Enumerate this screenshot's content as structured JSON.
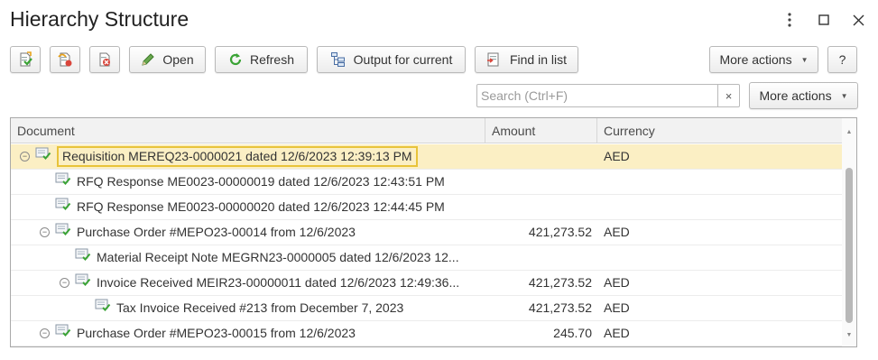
{
  "window": {
    "title": "Hierarchy Structure",
    "controls": {
      "menu_icon": "more-vert-icon",
      "maximize_icon": "maximize-icon",
      "close_icon": "close-icon"
    }
  },
  "toolbar": {
    "open_label": "Open",
    "refresh_label": "Refresh",
    "output_label": "Output for current",
    "find_label": "Find in list",
    "more_actions_label": "More actions",
    "help_label": "?"
  },
  "search": {
    "placeholder": "Search (Ctrl+F)",
    "value": "",
    "clear_label": "×",
    "more_actions_label": "More actions"
  },
  "table": {
    "columns": [
      "Document",
      "Amount",
      "Currency"
    ],
    "rows": [
      {
        "level": 0,
        "toggle": "⊖",
        "document": "Requisition MEREQ23-0000021 dated 12/6/2023 12:39:13 PM",
        "amount": "",
        "currency": "AED",
        "selected": true
      },
      {
        "level": 1,
        "toggle": "",
        "document": "RFQ Response ME0023-00000019 dated 12/6/2023 12:43:51 PM",
        "amount": "",
        "currency": ""
      },
      {
        "level": 1,
        "toggle": "",
        "document": "RFQ Response ME0023-00000020 dated 12/6/2023 12:44:45 PM",
        "amount": "",
        "currency": ""
      },
      {
        "level": 1,
        "toggle": "⊖",
        "document": "Purchase Order #MEPO23-00014 from 12/6/2023",
        "amount": "421,273.52",
        "currency": "AED"
      },
      {
        "level": 2,
        "toggle": "",
        "document": "Material Receipt Note MEGRN23-0000005 dated 12/6/2023 12...",
        "amount": "",
        "currency": ""
      },
      {
        "level": 2,
        "toggle": "⊖",
        "document": "Invoice Received MEIR23-00000011 dated 12/6/2023 12:49:36...",
        "amount": "421,273.52",
        "currency": "AED"
      },
      {
        "level": 3,
        "toggle": "",
        "document": "Tax Invoice Received #213 from December 7, 2023",
        "amount": "421,273.52",
        "currency": "AED"
      },
      {
        "level": 1,
        "toggle": "⊖",
        "document": "Purchase Order #MEPO23-00015 from 12/6/2023",
        "amount": "245.70",
        "currency": "AED"
      }
    ]
  },
  "colors": {
    "selected_row": "#fbefc4",
    "selection_border": "#e8c33a",
    "header_bg": "#f2f2f2",
    "doc_icon_check": "#3aa335"
  }
}
